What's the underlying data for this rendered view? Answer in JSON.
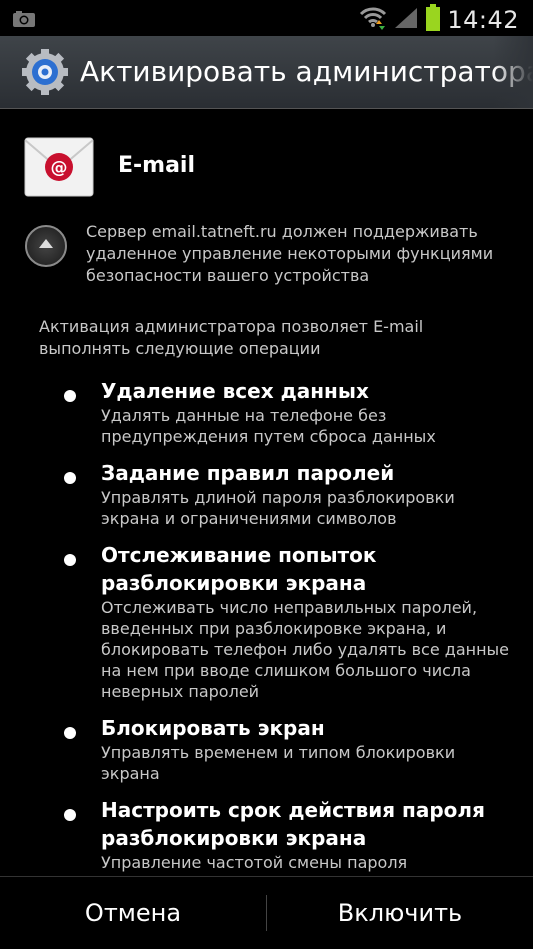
{
  "status_bar": {
    "time": "14:42",
    "icons": [
      "camera-icon",
      "wifi-icon",
      "signal-icon",
      "battery-icon"
    ],
    "battery_color": "#9ad51f"
  },
  "title_bar": {
    "icon": "gear-icon",
    "title": "Активировать администратора у"
  },
  "app": {
    "icon": "email-envelope-icon",
    "name": "E-mail"
  },
  "server_note": "Сервер email.tatneft.ru должен поддерживать удаленное управление некоторыми функциями безопасности вашего устройства",
  "intro": "Активация администратора позволяет E-mail выполнять следующие операции",
  "permissions": [
    {
      "title": "Удаление всех данных",
      "desc": "Удалять данные на телефоне без предупреждения путем сброса данных"
    },
    {
      "title": "Задание правил паролей",
      "desc": "Управлять длиной пароля разблокировки экрана и ограничениями символов"
    },
    {
      "title": "Отслеживание попыток разблокировки экрана",
      "desc": "Отслеживать число неправильных паролей, введенных при разблокировке экрана, и блокировать телефон либо удалять все данные на нем при вводе слишком большого числа неверных паролей"
    },
    {
      "title": "Блокировать экран",
      "desc": "Управлять временем и типом блокировки экрана"
    },
    {
      "title": "Настроить срок действия пароля разблокировки экрана",
      "desc": "Управление частотой смены пароля"
    }
  ],
  "buttons": {
    "cancel": "Отмена",
    "enable": "Включить"
  }
}
